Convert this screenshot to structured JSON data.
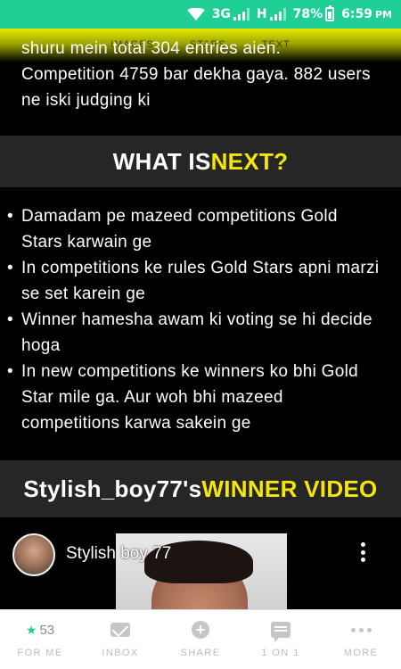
{
  "status_bar": {
    "network": "3G",
    "network2": "H",
    "battery": "78%",
    "time": "6:59",
    "ampm": "PM"
  },
  "ghost_tabs": [
    "IMAGES",
    "STARS",
    "TEXT"
  ],
  "intro": {
    "text": "shuru mein total 304 entries aien. Competition 4759 bar dekha gaya. 882 users ne iski judging ki"
  },
  "section_next": {
    "title_plain": "WHAT IS ",
    "title_highlight": "NEXT?"
  },
  "bullets": [
    "Damadam pe mazeed competitions Gold Stars karwain ge",
    "In competitions ke rules Gold Stars apni marzi se set karein ge",
    "Winner hamesha awam ki voting se hi decide hoga",
    "In new competitions ke winners ko bhi Gold Star mile ga. Aur woh bhi mazeed competitions karwa sakein ge"
  ],
  "section_winner": {
    "title_plain": "Stylish_boy77's ",
    "title_highlight": "WINNER VIDEO"
  },
  "video": {
    "channel_name": "Stylish boy 77"
  },
  "bottom_nav": {
    "for_me": {
      "count": "53",
      "label": "FOR ME"
    },
    "inbox": {
      "label": "INBOX"
    },
    "share": {
      "label": "SHARE"
    },
    "one_on_one": {
      "label": "1 ON 1"
    },
    "more": {
      "label": "MORE"
    }
  },
  "colors": {
    "accent_yellow": "#f5e50a",
    "status_green": "#1fcf95",
    "band_gray": "#262626"
  }
}
